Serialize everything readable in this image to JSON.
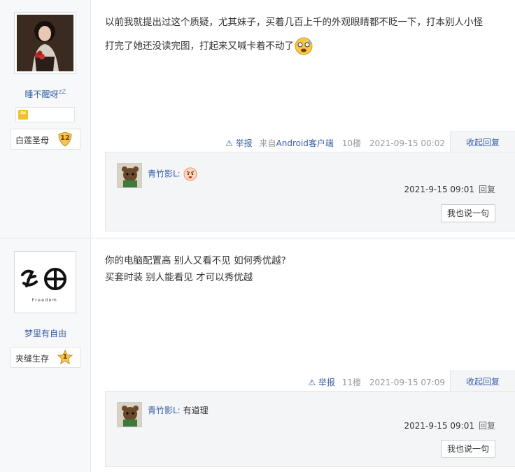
{
  "post1": {
    "author": {
      "name": "睡不醒呀",
      "name_suffix": "zZ",
      "title": "白莲圣母",
      "level": "12"
    },
    "lines": [
      "以前我就提出过这个质疑，尤其妹子，买着几百上千的外观眼睛都不眨一下，打本别人小怪",
      "打完了她还没读完图，打起来又喊卡着不动了"
    ],
    "tail": {
      "report": "举报",
      "from_prefix": "来自",
      "from_client": "Android客户端",
      "floor": "10楼",
      "time": "2021-09-15 00:02",
      "fold": "收起回复"
    },
    "reply": {
      "user": "青竹影L:",
      "text": "",
      "time": "2021-9-15 09:01",
      "reply_label": "回复",
      "say_button": "我也说一句"
    }
  },
  "post2": {
    "author": {
      "name": "梦里有自由",
      "title": "夹缝生存",
      "level": "1",
      "avatar_caption": "Freedom"
    },
    "lines": [
      "你的电脑配置高 别人又看不见 如何秀优越?",
      "买套时装 别人能看见 才可以秀优越"
    ],
    "tail": {
      "report": "举报",
      "floor": "11楼",
      "time": "2021-09-15 07:09",
      "fold": "收起回复"
    },
    "reply": {
      "user": "青竹影L:",
      "text": "有道理",
      "time": "2021-9-15 09:01",
      "reply_label": "回复",
      "say_button": "我也说一句"
    }
  },
  "colors": {
    "link": "#3a61a6",
    "sidebar_bg": "#f7f8fa",
    "reply_bg": "#f3f5f7"
  }
}
